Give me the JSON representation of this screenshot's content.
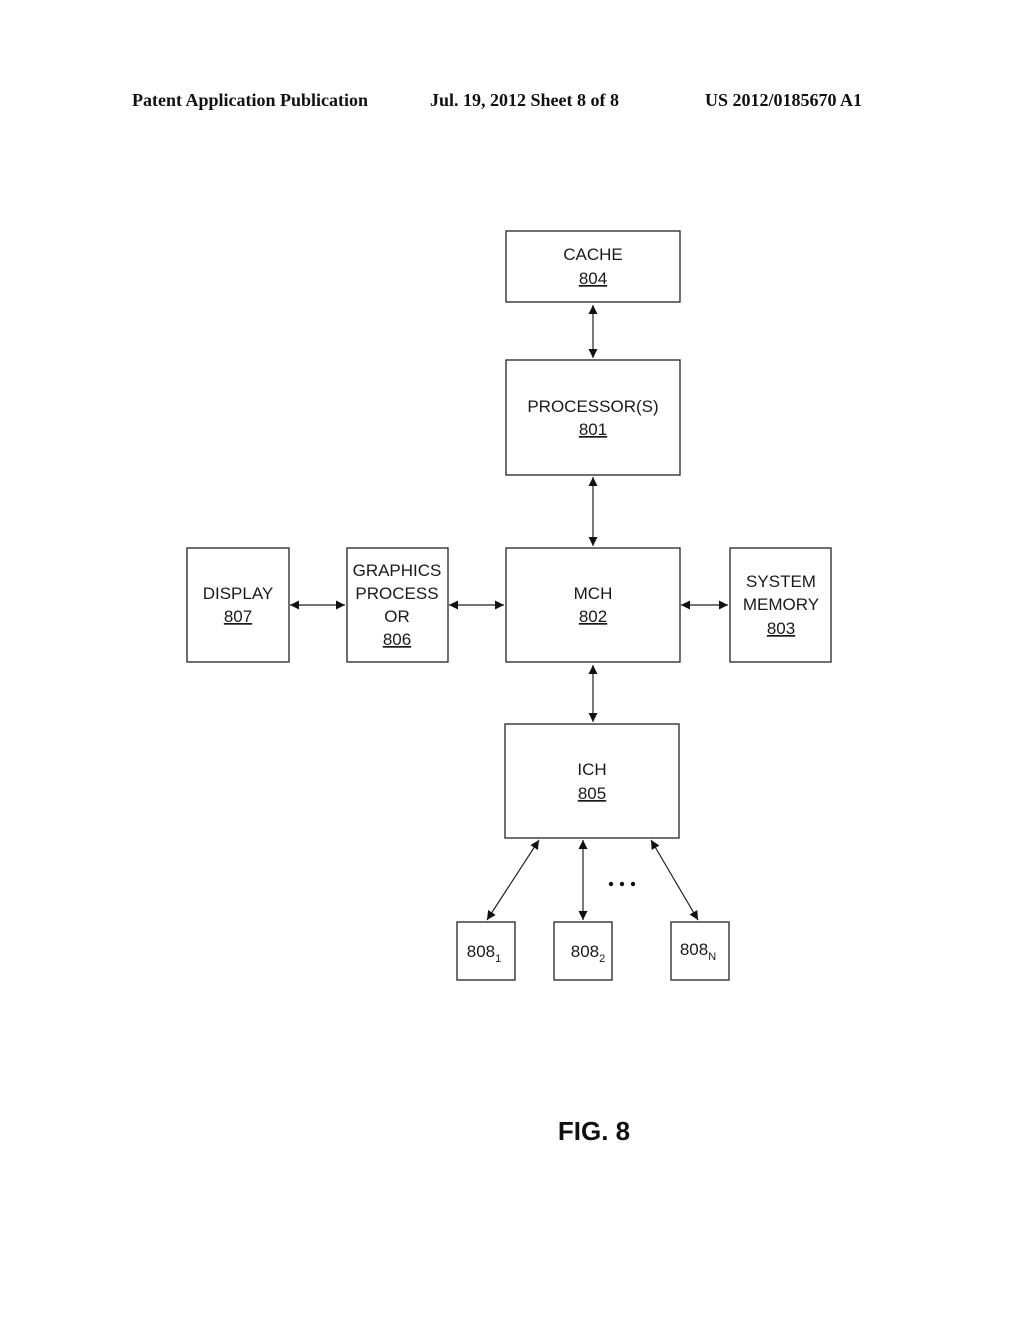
{
  "header": {
    "left": "Patent Application Publication",
    "middle": "Jul. 19, 2012   Sheet 8 of 8",
    "right": "US 2012/0185670 A1"
  },
  "diagram": {
    "blocks": {
      "cache": {
        "lines": [
          "CACHE"
        ],
        "ref": "804"
      },
      "processor": {
        "lines": [
          "PROCESSOR(S)"
        ],
        "ref": "801"
      },
      "mch": {
        "lines": [
          "MCH"
        ],
        "ref": "802"
      },
      "system_memory": {
        "lines": [
          "SYSTEM",
          "MEMORY"
        ],
        "ref": "803"
      },
      "graphics_processor": {
        "lines": [
          "GRAPHICS",
          "PROCESS",
          "OR"
        ],
        "ref": "806"
      },
      "display": {
        "lines": [
          "DISPLAY"
        ],
        "ref": "807"
      },
      "ich": {
        "lines": [
          "ICH"
        ],
        "ref": "805"
      },
      "device1": {
        "ref": "808",
        "subscript": "1"
      },
      "device2": {
        "ref": "808",
        "subscript": "2"
      },
      "deviceN": {
        "ref": "808",
        "subscript": "N"
      }
    },
    "connections": [
      {
        "from": "cache",
        "to": "processor",
        "type": "bidirectional"
      },
      {
        "from": "processor",
        "to": "mch",
        "type": "bidirectional"
      },
      {
        "from": "display",
        "to": "graphics_processor",
        "type": "bidirectional"
      },
      {
        "from": "graphics_processor",
        "to": "mch",
        "type": "bidirectional"
      },
      {
        "from": "mch",
        "to": "system_memory",
        "type": "bidirectional"
      },
      {
        "from": "mch",
        "to": "ich",
        "type": "bidirectional"
      },
      {
        "from": "ich",
        "to": "device1",
        "type": "bidirectional"
      },
      {
        "from": "ich",
        "to": "device2",
        "type": "bidirectional"
      },
      {
        "from": "ich",
        "to": "deviceN",
        "type": "bidirectional"
      }
    ],
    "ellipsis": "• • •"
  },
  "figure_label": "FIG. 8"
}
